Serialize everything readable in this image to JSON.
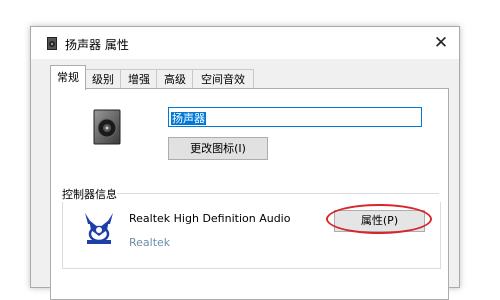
{
  "window": {
    "title": "扬声器 属性",
    "close_icon": "close-icon"
  },
  "tabs": [
    {
      "label": "常规",
      "active": true
    },
    {
      "label": "级别",
      "active": false
    },
    {
      "label": "增强",
      "active": false
    },
    {
      "label": "高级",
      "active": false
    },
    {
      "label": "空间音效",
      "active": false
    }
  ],
  "general": {
    "device_name_value": "扬声器",
    "change_icon_label": "更改图标(I)",
    "controller_group_label": "控制器信息",
    "controller_name": "Realtek High Definition Audio",
    "controller_vendor": "Realtek",
    "properties_label": "属性(P)"
  },
  "colors": {
    "selection": "#0078d7",
    "annotation_circle": "#d7262b",
    "vendor_text": "#6b8fa8"
  }
}
